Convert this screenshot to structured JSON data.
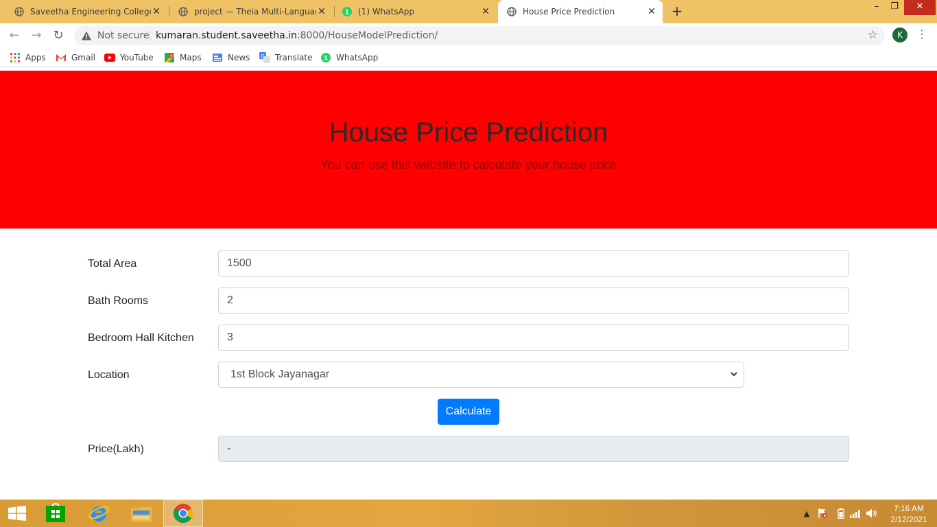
{
  "browser": {
    "tabs": [
      {
        "label": "Saveetha Engineering College",
        "icon": "globe-icon",
        "active": false
      },
      {
        "label": "project — Theia Multi-Language",
        "icon": "globe-icon",
        "active": false
      },
      {
        "label": "(1) WhatsApp",
        "icon": "whatsapp-icon",
        "active": false
      },
      {
        "label": "House Price Prediction",
        "icon": "globe-icon",
        "active": true
      }
    ],
    "new_tab": "+",
    "window_controls": {
      "minimize": "–",
      "restore": "❐",
      "close": "✕"
    },
    "address": {
      "security_label": "Not secure",
      "host": "kumaran.student.saveetha.in",
      "path": ":8000/HouseModelPrediction/"
    },
    "profile_initial": "K",
    "bookmarks": [
      {
        "label": "Apps",
        "icon": "apps-grid-icon"
      },
      {
        "label": "Gmail",
        "icon": "gmail-icon"
      },
      {
        "label": "YouTube",
        "icon": "youtube-icon"
      },
      {
        "label": "Maps",
        "icon": "maps-icon"
      },
      {
        "label": "News",
        "icon": "news-icon"
      },
      {
        "label": "Translate",
        "icon": "translate-icon"
      },
      {
        "label": "WhatsApp",
        "icon": "whatsapp-icon"
      }
    ]
  },
  "page": {
    "title": "House Price Prediction",
    "subtitle": "You can use this website to calculate your house price",
    "form": {
      "total_area": {
        "label": "Total Area",
        "value": "1500"
      },
      "bath_rooms": {
        "label": "Bath Rooms",
        "value": "2"
      },
      "bhk": {
        "label": "Bedroom Hall Kitchen",
        "value": "3"
      },
      "location": {
        "label": "Location",
        "selected": "1st Block Jayanagar"
      },
      "calculate_label": "Calculate",
      "price": {
        "label": "Price(Lakh)",
        "value": "-"
      }
    },
    "colors": {
      "hero": "#ff0000",
      "button": "#007bff"
    }
  },
  "taskbar": {
    "apps": [
      "windows-start-icon",
      "store-icon",
      "internet-explorer-icon",
      "file-explorer-icon",
      "chrome-icon"
    ],
    "clock_time": "7:16 AM",
    "clock_date": "2/12/2021"
  }
}
